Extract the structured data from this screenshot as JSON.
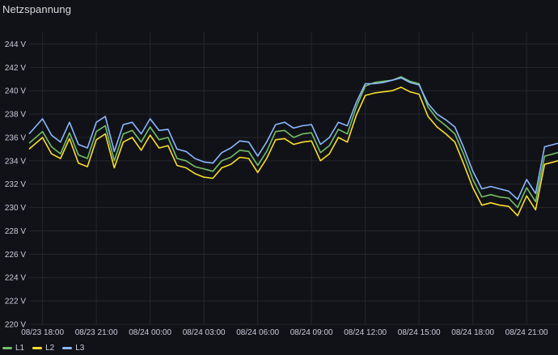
{
  "panel": {
    "title": "Netzspannung"
  },
  "chart_data": {
    "type": "line",
    "title": "Netzspannung",
    "xlabel": "",
    "ylabel": "",
    "unit": "V",
    "ylim": [
      220,
      245
    ],
    "y_ticks": [
      "220 V",
      "222 V",
      "224 V",
      "226 V",
      "228 V",
      "230 V",
      "232 V",
      "234 V",
      "236 V",
      "238 V",
      "240 V",
      "242 V",
      "244 V"
    ],
    "x_ticks": [
      "08/23 18:00",
      "08/23 21:00",
      "08/24 00:00",
      "08/24 03:00",
      "08/24 06:00",
      "08/24 09:00",
      "08/24 12:00",
      "08/24 15:00",
      "08/24 18:00",
      "08/24 21:00"
    ],
    "x_range_hours": [
      "08/23 17:15",
      "08/24 22:45"
    ],
    "grid": true,
    "legend": "bottom-left",
    "series": [
      {
        "name": "L1",
        "color": "#73bf69",
        "x": [
          "08/23 17:15",
          "08/23 18:00",
          "08/23 18:30",
          "08/23 19:00",
          "08/23 19:30",
          "08/23 20:00",
          "08/23 20:30",
          "08/23 21:00",
          "08/23 21:30",
          "08/23 22:00",
          "08/23 22:30",
          "08/23 23:00",
          "08/23 23:30",
          "08/24 00:00",
          "08/24 00:30",
          "08/24 01:00",
          "08/24 01:30",
          "08/24 02:00",
          "08/24 02:30",
          "08/24 03:00",
          "08/24 03:30",
          "08/24 04:00",
          "08/24 04:30",
          "08/24 05:00",
          "08/24 05:30",
          "08/24 06:00",
          "08/24 06:30",
          "08/24 07:00",
          "08/24 07:30",
          "08/24 08:00",
          "08/24 08:30",
          "08/24 09:00",
          "08/24 09:30",
          "08/24 10:00",
          "08/24 10:30",
          "08/24 11:00",
          "08/24 11:30",
          "08/24 12:00",
          "08/24 12:30",
          "08/24 13:00",
          "08/24 13:30",
          "08/24 14:00",
          "08/24 14:30",
          "08/24 15:00",
          "08/24 15:30",
          "08/24 16:00",
          "08/24 16:30",
          "08/24 17:00",
          "08/24 17:30",
          "08/24 18:00",
          "08/24 18:30",
          "08/24 19:00",
          "08/24 19:30",
          "08/24 20:00",
          "08/24 20:30",
          "08/24 21:00",
          "08/24 21:30",
          "08/24 22:00",
          "08/24 22:30",
          "08/24 22:45"
        ],
        "values": [
          235.5,
          236.5,
          235.2,
          234.6,
          236.4,
          234.5,
          234.2,
          236.5,
          237.0,
          234.0,
          236.3,
          236.6,
          235.6,
          236.9,
          235.8,
          236.0,
          234.2,
          234.0,
          233.5,
          233.3,
          233.1,
          234.0,
          234.3,
          234.9,
          234.8,
          233.6,
          234.8,
          236.5,
          236.6,
          236.0,
          236.3,
          236.4,
          234.7,
          235.3,
          236.7,
          236.3,
          238.6,
          240.4,
          240.7,
          240.8,
          240.9,
          241.2,
          240.8,
          240.6,
          238.6,
          237.6,
          237.0,
          236.3,
          234.5,
          232.4,
          230.9,
          231.1,
          230.9,
          230.8,
          230.0,
          231.7,
          230.5,
          234.4,
          234.6,
          234.7
        ]
      },
      {
        "name": "L2",
        "color": "#fade2a",
        "x": [
          "08/23 17:15",
          "08/23 18:00",
          "08/23 18:30",
          "08/23 19:00",
          "08/23 19:30",
          "08/23 20:00",
          "08/23 20:30",
          "08/23 21:00",
          "08/23 21:30",
          "08/23 22:00",
          "08/23 22:30",
          "08/23 23:00",
          "08/23 23:30",
          "08/24 00:00",
          "08/24 00:30",
          "08/24 01:00",
          "08/24 01:30",
          "08/24 02:00",
          "08/24 02:30",
          "08/24 03:00",
          "08/24 03:30",
          "08/24 04:00",
          "08/24 04:30",
          "08/24 05:00",
          "08/24 05:30",
          "08/24 06:00",
          "08/24 06:30",
          "08/24 07:00",
          "08/24 07:30",
          "08/24 08:00",
          "08/24 08:30",
          "08/24 09:00",
          "08/24 09:30",
          "08/24 10:00",
          "08/24 10:30",
          "08/24 11:00",
          "08/24 11:30",
          "08/24 12:00",
          "08/24 12:30",
          "08/24 13:00",
          "08/24 13:30",
          "08/24 14:00",
          "08/24 14:30",
          "08/24 15:00",
          "08/24 15:30",
          "08/24 16:00",
          "08/24 16:30",
          "08/24 17:00",
          "08/24 17:30",
          "08/24 18:00",
          "08/24 18:30",
          "08/24 19:00",
          "08/24 19:30",
          "08/24 20:00",
          "08/24 20:30",
          "08/24 21:00",
          "08/24 21:30",
          "08/24 22:00",
          "08/24 22:30",
          "08/24 22:45"
        ],
        "values": [
          235.0,
          236.0,
          234.6,
          234.2,
          235.9,
          233.8,
          233.5,
          235.8,
          236.3,
          233.4,
          235.6,
          236.0,
          234.9,
          236.2,
          235.1,
          235.3,
          233.6,
          233.4,
          232.9,
          232.6,
          232.5,
          233.4,
          233.7,
          234.3,
          234.2,
          233.0,
          234.2,
          235.8,
          235.9,
          235.4,
          235.6,
          235.7,
          234.0,
          234.6,
          236.0,
          235.6,
          237.9,
          239.6,
          239.8,
          239.9,
          240.0,
          240.3,
          239.9,
          239.7,
          237.8,
          236.9,
          236.3,
          235.6,
          233.7,
          231.7,
          230.2,
          230.4,
          230.2,
          230.1,
          229.3,
          231.0,
          229.8,
          233.7,
          233.9,
          234.0
        ]
      },
      {
        "name": "L3",
        "color": "#8ab8ff",
        "x": [
          "08/23 17:15",
          "08/23 18:00",
          "08/23 18:30",
          "08/23 19:00",
          "08/23 19:30",
          "08/23 20:00",
          "08/23 20:30",
          "08/23 21:00",
          "08/23 21:30",
          "08/23 22:00",
          "08/23 22:30",
          "08/23 23:00",
          "08/23 23:30",
          "08/24 00:00",
          "08/24 00:30",
          "08/24 01:00",
          "08/24 01:30",
          "08/24 02:00",
          "08/24 02:30",
          "08/24 03:00",
          "08/24 03:30",
          "08/24 04:00",
          "08/24 04:30",
          "08/24 05:00",
          "08/24 05:30",
          "08/24 06:00",
          "08/24 06:30",
          "08/24 07:00",
          "08/24 07:30",
          "08/24 08:00",
          "08/24 08:30",
          "08/24 09:00",
          "08/24 09:30",
          "08/24 10:00",
          "08/24 10:30",
          "08/24 11:00",
          "08/24 11:30",
          "08/24 12:00",
          "08/24 12:30",
          "08/24 13:00",
          "08/24 13:30",
          "08/24 14:00",
          "08/24 14:30",
          "08/24 15:00",
          "08/24 15:30",
          "08/24 16:00",
          "08/24 16:30",
          "08/24 17:00",
          "08/24 17:30",
          "08/24 18:00",
          "08/24 18:30",
          "08/24 19:00",
          "08/24 19:30",
          "08/24 20:00",
          "08/24 20:30",
          "08/24 21:00",
          "08/24 21:30",
          "08/24 22:00",
          "08/24 22:30",
          "08/24 22:45"
        ],
        "values": [
          236.3,
          237.6,
          236.2,
          235.6,
          237.3,
          235.4,
          235.1,
          237.3,
          237.8,
          234.8,
          237.1,
          237.3,
          236.3,
          237.6,
          236.6,
          236.7,
          235.0,
          234.8,
          234.2,
          233.9,
          233.8,
          234.7,
          235.1,
          235.7,
          235.6,
          234.4,
          235.6,
          237.1,
          237.3,
          236.8,
          237.0,
          237.1,
          235.4,
          236.0,
          237.3,
          237.0,
          239.0,
          240.6,
          240.6,
          240.7,
          240.9,
          241.1,
          240.7,
          240.5,
          238.9,
          238.0,
          237.5,
          236.9,
          235.1,
          233.1,
          231.6,
          231.8,
          231.6,
          231.4,
          230.7,
          232.4,
          231.2,
          235.2,
          235.4,
          235.5
        ]
      }
    ]
  }
}
